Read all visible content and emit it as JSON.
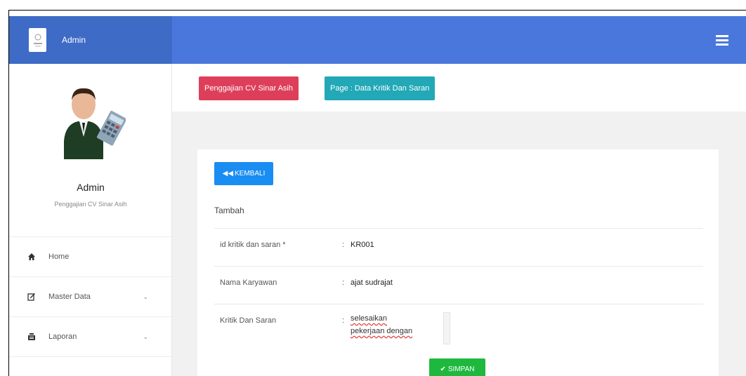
{
  "header": {
    "brand_title": "Admin",
    "brand_color": "#3e6bc6",
    "topbar_color": "#4a77dc"
  },
  "sidebar": {
    "user_name": "Admin",
    "user_subtitle": "Penggajian CV Sinar Asih",
    "items": [
      {
        "label": "Home",
        "icon": "home-icon"
      },
      {
        "label": "Master Data",
        "icon": "edit-icon"
      },
      {
        "label": "Laporan",
        "icon": "list-icon"
      }
    ]
  },
  "breadcrumb": {
    "app": "Penggajian CV Sinar Asih",
    "page": "Page : Data Kritik Dan Saran"
  },
  "form": {
    "back_label": "KEMBALI",
    "section_title": "Tambah",
    "id_label": "id kritik dan saran *",
    "id_value": "KR001",
    "name_label": "Nama Karyawan",
    "name_value": "ajat sudrajat",
    "kritik_label": "Kritik Dan Saran",
    "kritik_line1": "selesaikan",
    "kritik_line2": "pekerjaan dengan",
    "colon": ":",
    "save_label": "SIMPAN"
  }
}
